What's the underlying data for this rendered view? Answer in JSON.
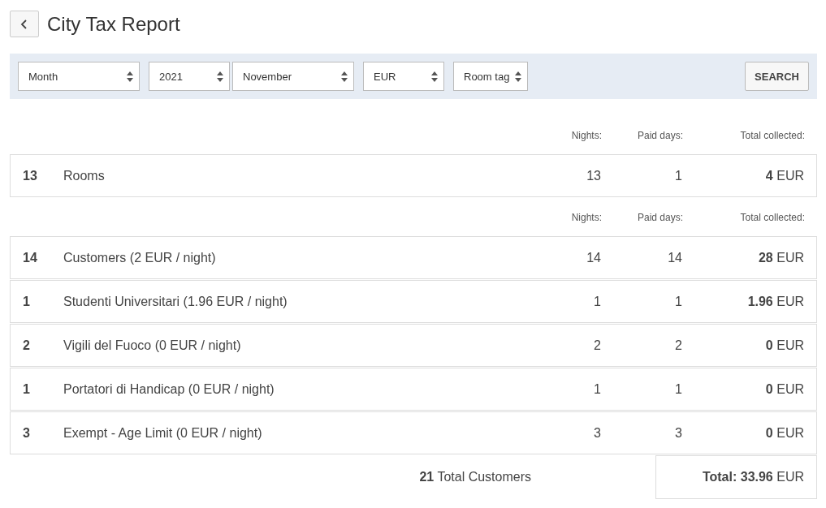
{
  "title": "City Tax Report",
  "filters": [
    {
      "value": "Month"
    },
    {
      "value": "2021"
    },
    {
      "value": "November"
    },
    {
      "value": "EUR"
    },
    {
      "value": "Room tag"
    }
  ],
  "search_button": "SEARCH",
  "rooms_section": {
    "columns": [
      "Nights:",
      "Paid days:",
      "Total collected:"
    ],
    "rows": [
      {
        "count": "13",
        "label": "Rooms",
        "nights": "13",
        "paid_days": "1",
        "total": "**4** EUR"
      }
    ]
  },
  "customers_section": {
    "columns": [
      "Nights:",
      "Paid days:",
      "Total collected:"
    ],
    "rows": [
      {
        "count": "14",
        "label": "Customers (2 EUR / night)",
        "nights": "14",
        "paid_days": "14",
        "total": "**28** EUR"
      },
      {
        "count": "1",
        "label": "Studenti Universitari (1.96 EUR / night)",
        "nights": "1",
        "paid_days": "1",
        "total": "**1.96** EUR"
      },
      {
        "count": "2",
        "label": "Vigili del Fuoco (0 EUR / night)",
        "nights": "2",
        "paid_days": "2",
        "total": "**0** EUR"
      },
      {
        "count": "1",
        "label": "Portatori di Handicap (0 EUR / night)",
        "nights": "1",
        "paid_days": "1",
        "total": "**0** EUR"
      },
      {
        "count": "3",
        "label": "Exempt - Age Limit (0 EUR / night)",
        "nights": "3",
        "paid_days": "3",
        "total": "**0** EUR"
      }
    ]
  },
  "footer": {
    "total_customers": "**21** Total Customers",
    "grand_total": "**Total: 33.96** EUR"
  }
}
